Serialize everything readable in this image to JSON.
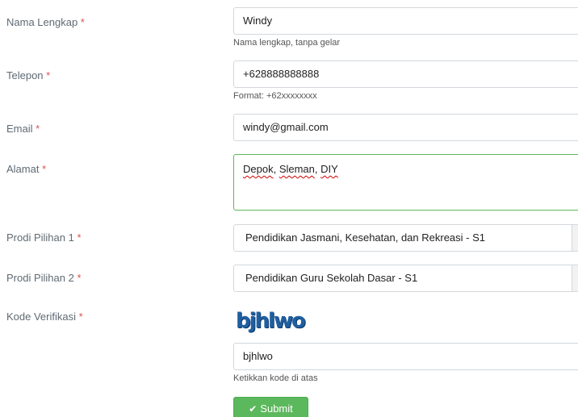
{
  "form": {
    "nama": {
      "label": "Nama Lengkap",
      "required_mark": "*",
      "value": "Windy",
      "help": "Nama lengkap, tanpa gelar"
    },
    "telepon": {
      "label": "Telepon",
      "required_mark": "*",
      "value": "+628888888888",
      "help": "Format: +62xxxxxxxx"
    },
    "email": {
      "label": "Email",
      "required_mark": "*",
      "value": "windy@gmail.com"
    },
    "alamat": {
      "label": "Alamat",
      "required_mark": "*",
      "words": [
        "Depok",
        "Sleman",
        "DIY"
      ],
      "sep1": ", ",
      "sep2": ", "
    },
    "prodi1": {
      "label": "Prodi Pilihan 1",
      "required_mark": "*",
      "selected": "Pendidikan Jasmani, Kesehatan, dan Rekreasi - S1"
    },
    "prodi2": {
      "label": "Prodi Pilihan 2",
      "required_mark": "*",
      "selected": "Pendidikan Guru Sekolah Dasar - S1"
    },
    "kode": {
      "label": "Kode Verifikasi",
      "required_mark": "*",
      "captcha_text": "bjhlwo",
      "value": "bjhlwo",
      "help": "Ketikkan kode di atas"
    },
    "submit_label": "Submit"
  },
  "colors": {
    "required": "#d9534f",
    "accent_green": "#5cb85c",
    "captcha": "#1f5fa0"
  },
  "icons": {
    "submit": "check-icon"
  }
}
